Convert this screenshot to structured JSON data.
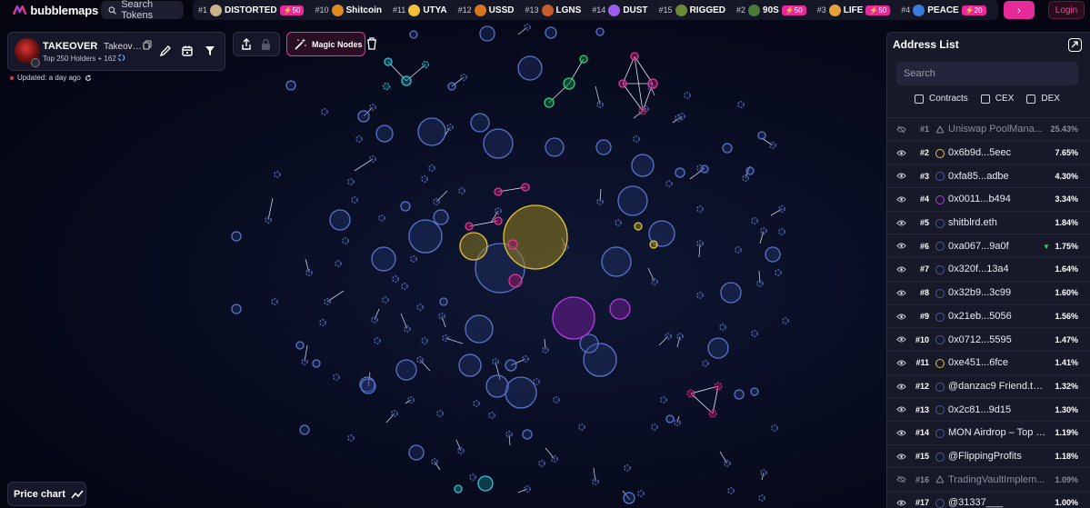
{
  "app": {
    "name": "bubblemaps",
    "search_label": "Search Tokens",
    "login_label": "Login",
    "more_label": "›"
  },
  "ticker": [
    {
      "rank": "#1",
      "symbol": "DISTORTED",
      "badge": "50",
      "icon_color": "#c9b48a"
    },
    {
      "rank": "#10",
      "symbol": "Shitcoin",
      "badge": "",
      "icon_color": "#e08a1e"
    },
    {
      "rank": "#11",
      "symbol": "UTYA",
      "badge": "",
      "icon_color": "#f0c23a"
    },
    {
      "rank": "#12",
      "symbol": "USSD",
      "badge": "",
      "icon_color": "#d9761e"
    },
    {
      "rank": "#13",
      "symbol": "LGNS",
      "badge": "",
      "icon_color": "#c95a2a"
    },
    {
      "rank": "#14",
      "symbol": "DUST",
      "badge": "",
      "icon_color": "#9b5cf0"
    },
    {
      "rank": "#15",
      "symbol": "RIGGED",
      "badge": "",
      "icon_color": "#6a8a3a"
    },
    {
      "rank": "#2",
      "symbol": "90S",
      "badge": "50",
      "icon_color": "#4a7a3a"
    },
    {
      "rank": "#3",
      "symbol": "LIFE",
      "badge": "50",
      "icon_color": "#e3a338"
    },
    {
      "rank": "#4",
      "symbol": "PEACE",
      "badge": "20",
      "icon_color": "#3a7ad9"
    }
  ],
  "token": {
    "symbol": "TAKEOVER",
    "name": "Takeover...",
    "holders": "Top 250 Holders + 162",
    "updated": "Updated: a day ago"
  },
  "toolbar": {
    "magic_label": "Magic Nodes",
    "price_chart_label": "Price chart"
  },
  "panel": {
    "title": "Address List",
    "search_placeholder": "Search",
    "filters": [
      "Contracts",
      "CEX",
      "DEX"
    ],
    "rows": [
      {
        "rank": "#1",
        "name": "Uniswap PoolMana...",
        "pct": "25.43%",
        "hidden": true,
        "dot": "contract",
        "color": "#8a8c9e"
      },
      {
        "rank": "#2",
        "name": "0x6b9d...5eec",
        "pct": "7.65%",
        "hidden": false,
        "dot": "circle",
        "color": "#e2c23a"
      },
      {
        "rank": "#3",
        "name": "0xfa85...adbe",
        "pct": "4.30%",
        "hidden": false,
        "dot": "circle",
        "color": "#4a5a9a"
      },
      {
        "rank": "#4",
        "name": "0x0011...b494",
        "pct": "3.34%",
        "hidden": false,
        "dot": "circle",
        "color": "#b23ee0"
      },
      {
        "rank": "#5",
        "name": "shitblrd.eth",
        "pct": "1.84%",
        "hidden": false,
        "dot": "circle",
        "color": "#4a5a9a"
      },
      {
        "rank": "#6",
        "name": "0xa067...9a0f",
        "pct": "1.75%",
        "hidden": false,
        "dot": "circle",
        "color": "#4a5a9a",
        "flag": "green"
      },
      {
        "rank": "#7",
        "name": "0x320f...13a4",
        "pct": "1.64%",
        "hidden": false,
        "dot": "circle",
        "color": "#4a5a9a"
      },
      {
        "rank": "#8",
        "name": "0x32b9...3c99",
        "pct": "1.60%",
        "hidden": false,
        "dot": "circle",
        "color": "#4a5a9a"
      },
      {
        "rank": "#9",
        "name": "0x21eb...5056",
        "pct": "1.56%",
        "hidden": false,
        "dot": "circle",
        "color": "#4a5a9a"
      },
      {
        "rank": "#10",
        "name": "0x0712...5595",
        "pct": "1.47%",
        "hidden": false,
        "dot": "circle",
        "color": "#4a5a9a"
      },
      {
        "rank": "#11",
        "name": "0xe451...6fce",
        "pct": "1.41%",
        "hidden": false,
        "dot": "circle",
        "color": "#e2c23a"
      },
      {
        "rank": "#12",
        "name": "@danzac9 Friend.tec...",
        "pct": "1.32%",
        "hidden": false,
        "dot": "circle",
        "color": "#4a5a9a"
      },
      {
        "rank": "#13",
        "name": "0x2c81...9d15",
        "pct": "1.30%",
        "hidden": false,
        "dot": "circle",
        "color": "#4a5a9a"
      },
      {
        "rank": "#14",
        "name": "MON Airdrop – Top 12...",
        "pct": "1.19%",
        "hidden": false,
        "dot": "circle",
        "color": "#4a5a9a"
      },
      {
        "rank": "#15",
        "name": "@FlippingProfits",
        "pct": "1.18%",
        "hidden": false,
        "dot": "circle",
        "color": "#4a5a9a"
      },
      {
        "rank": "#16",
        "name": "TradingVaultImplem...",
        "pct": "1.09%",
        "hidden": true,
        "dot": "contract",
        "color": "#8a8c9e"
      },
      {
        "rank": "#17",
        "name": "@31337___",
        "pct": "1.00%",
        "hidden": false,
        "dot": "circle",
        "color": "#4a5a9a"
      }
    ]
  }
}
